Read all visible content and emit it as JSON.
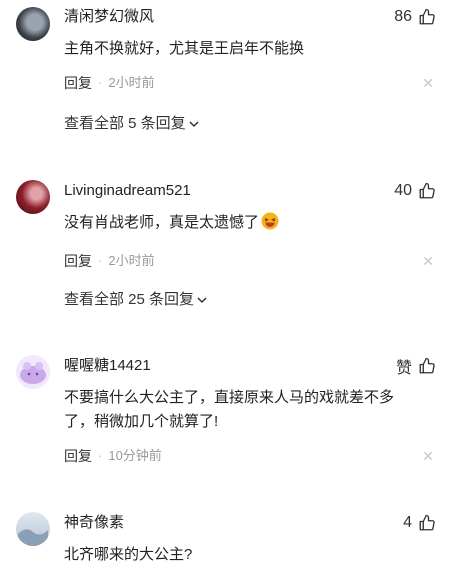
{
  "comments": [
    {
      "username": "清闲梦幻微风",
      "likes": "86",
      "text": "主角不换就好，尤其是王启年不能换",
      "reply_label": "回复",
      "time": "2小时前",
      "view_all": "查看全部 5 条回复"
    },
    {
      "username": "Livinginadream521",
      "likes": "40",
      "text": "没有肖战老师，真是太遗憾了",
      "reply_label": "回复",
      "time": "2小时前",
      "view_all": "查看全部 25 条回复"
    },
    {
      "username": "喔喔糖14421",
      "likes": "赞",
      "text": "不要搞什么大公主了，直接原来人马的戏就差不多了，稍微加几个就算了!",
      "reply_label": "回复",
      "time": "10分钟前"
    },
    {
      "username": "神奇像素",
      "likes": "4",
      "text": "北齐哪来的大公主?"
    }
  ],
  "icons": {
    "like": "thumbs-up-icon",
    "close": "close-icon",
    "expand": "chevron-down-icon",
    "emoji": "laughing-emoji-icon"
  }
}
